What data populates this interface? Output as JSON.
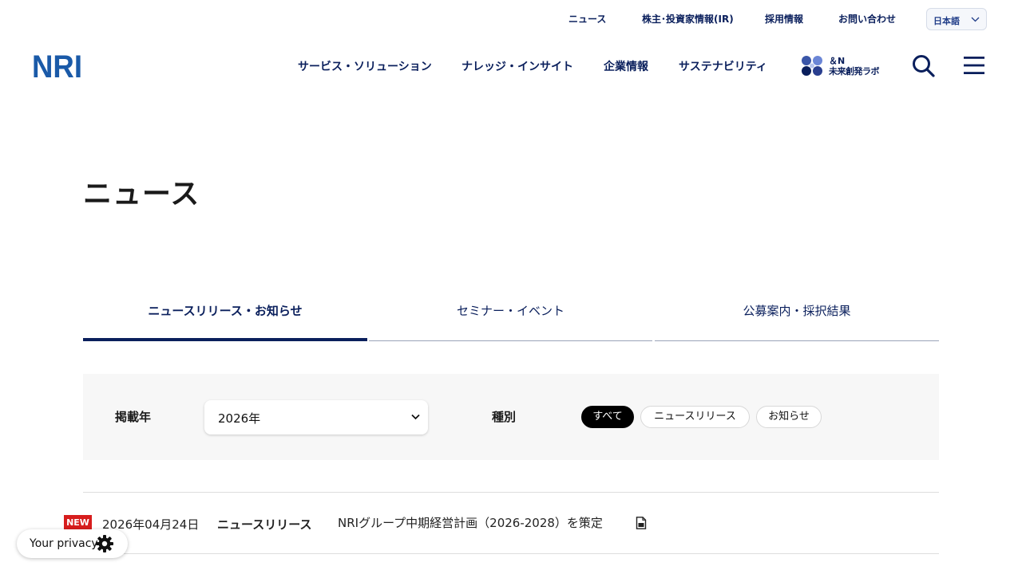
{
  "utility_nav": {
    "news": "ニュース",
    "ir": "株主･投資家情報(IR)",
    "recruit": "採用情報",
    "contact": "お問い合わせ",
    "language": "日本語"
  },
  "logo": {
    "text": "NRI",
    "color": "#1a5aa8"
  },
  "main_nav": {
    "items": [
      "サービス・ソリューション",
      "ナレッジ・インサイト",
      "企業情報",
      "サステナビリティ"
    ],
    "lab_line1": "＆N",
    "lab_line2": "未来創発ラボ"
  },
  "page": {
    "title": "ニュース"
  },
  "tabs": [
    {
      "label": "ニュースリリース・お知らせ",
      "active": true
    },
    {
      "label": "セミナー・イベント",
      "active": false
    },
    {
      "label": "公募案内・採択結果",
      "active": false
    }
  ],
  "filter": {
    "year_label": "掲載年",
    "year_value": "2026年",
    "type_label": "種別",
    "type_options": [
      {
        "label": "すべて",
        "active": true
      },
      {
        "label": "ニュースリリース",
        "active": false
      },
      {
        "label": "お知らせ",
        "active": false
      }
    ]
  },
  "news": [
    {
      "badge": "NEW",
      "date": "2026年04月24日",
      "category": "ニュースリリース",
      "title": "NRIグループ中期経営計画（2026-2028）を策定",
      "icon": "pdf-icon"
    }
  ],
  "privacy": {
    "label": "Your privacy",
    "icon": "gear-icon"
  },
  "colors": {
    "navy": "#0a1f5c",
    "new_badge": "#d71d1d",
    "filter_bg": "#f7f7f7"
  }
}
